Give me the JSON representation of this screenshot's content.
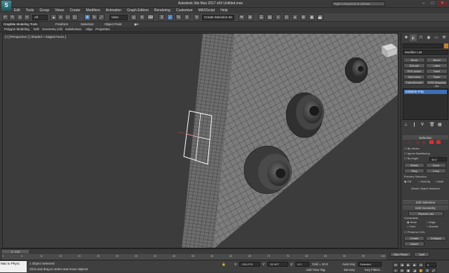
{
  "app": {
    "title": "Autodesk 3ds Max 2017 x64   Untitled.max",
    "logo": "S",
    "search_placeholder": "Type a keyword or phrase"
  },
  "menu": [
    "Edit",
    "Tools",
    "Group",
    "Views",
    "Create",
    "Modifiers",
    "Animation",
    "Graph Editors",
    "Rendering",
    "Customize",
    "MAXScript",
    "Help"
  ],
  "toolbar": {
    "selection_filter": "All",
    "reference_coord": "View",
    "named_selection": "Create Selection Se"
  },
  "ribbon": {
    "tabs": [
      "Graphite Modeling Tools",
      "Freeform",
      "Selection",
      "Object Paint"
    ],
    "subtabs": [
      "Polygon Modeling",
      "Edit",
      "Geometry (All)",
      "Subdivision",
      "Align",
      "Properties"
    ]
  },
  "viewport": {
    "label": "[+] [Perspective ] [ Shaded + Edged Faces ]"
  },
  "command_panel": {
    "object_name": "",
    "modifier_list": "Modifier List",
    "buttons": [
      "Bend",
      "Bevel",
      "Extrude",
      "Lathe",
      "FFD 3x3x3",
      "Shell",
      "Symmetry",
      "Taper",
      "TurboSmooth",
      "UVW Mapping Cle"
    ],
    "stack_item": "Editable Poly",
    "selection_rollout": "Selection",
    "by_vertex": "By Vertex",
    "ignore_backfacing": "Ignore Backfacing",
    "by_angle": "By Angle",
    "by_angle_value": "45.0",
    "shrink": "Shrink",
    "grow": "Grow",
    "ring": "Ring",
    "loop": "Loop",
    "preview_selection": "Preview Selection",
    "preview_options": [
      "Off",
      "SubObj",
      "Multi"
    ],
    "whole_selected": "Whole Object Selected",
    "soft_selection": "Soft Selection",
    "edit_geometry": "Edit Geometry",
    "repeat_last": "Repeat Last",
    "constraints": "Constraints",
    "constraint_options": [
      "None",
      "Edge",
      "Face",
      "Normal"
    ],
    "preserve_uvs": "Preserve UVs",
    "create": "Create",
    "collapse": "Collapse",
    "attach": "Attach",
    "slice_plane": "Slice Plane",
    "split": "Split"
  },
  "timeline": {
    "slider": "0 / 100",
    "ticks": [
      "0",
      "5",
      "10",
      "15",
      "20",
      "25",
      "30",
      "35",
      "40",
      "45",
      "50",
      "55",
      "60",
      "65",
      "70",
      "75",
      "80",
      "85",
      "90",
      "95",
      "100"
    ]
  },
  "status": {
    "maxscript_line1": "Max to Physc",
    "maxscript_line2": "",
    "selected": "1 Object Selected",
    "hint": "Click and drag to select and move objects",
    "x_label": "X:",
    "x_value": "-324.076",
    "y_label": "Y:",
    "y_value": "-32.007",
    "z_label": "Z:",
    "z_value": "0.0",
    "grid": "Grid = 10.0",
    "add_time_tag": "Add Time Tag",
    "auto_key": "Auto Key",
    "set_key": "Set Key",
    "key_mode": "Selected",
    "key_filters": "Key Filters...",
    "frame": "0"
  },
  "colors": {
    "accent": "#3d6fb5",
    "viewport_bg": "#3c3c3c",
    "wire": "#1c1c1c",
    "selection": "#ffffff"
  }
}
